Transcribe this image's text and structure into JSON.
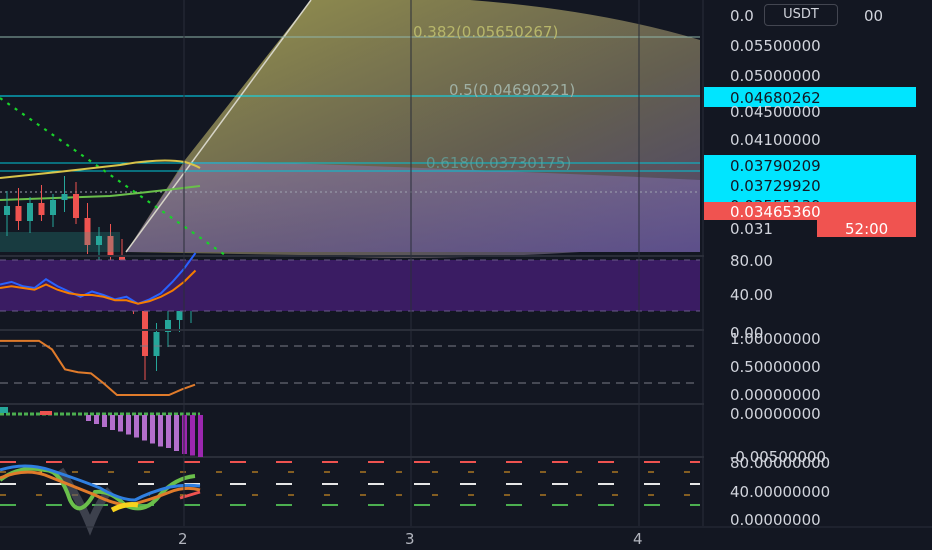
{
  "currency_button": "USDT",
  "price_axis_labels": [
    "0.05500000",
    "0.05000000",
    "0.04500000",
    "0.04100000"
  ],
  "price_axis_top_partial": "0.0",
  "price_axis_top_partial_tail": "00",
  "price_axis_bottom_partial": "0.031",
  "fib_labels": [
    {
      "text": "0.382(0.05650267)",
      "color": "#b7b66a"
    },
    {
      "text": "0.5(0.04690221)",
      "color": "#9fb0a4"
    },
    {
      "text": "0.618(0.03730175)",
      "color": "#63a5a0"
    }
  ],
  "price_tags": [
    {
      "text": "0.04680262",
      "bg": "#00e5ff"
    },
    {
      "text": "0.03790209",
      "bg": "#00e5ff"
    },
    {
      "text": "0.03729920",
      "bg": "#00e5ff"
    },
    {
      "text": "0.03551139",
      "bg": "#00e5ff"
    },
    {
      "text": "0.03465360",
      "bg": "#f05350"
    }
  ],
  "countdown_tag": {
    "text": "52:00",
    "bg": "#f05350"
  },
  "rsi_axis": [
    "80.00",
    "40.00",
    "0.00"
  ],
  "stoch_axis": [
    "1.00000000",
    "0.50000000",
    "0.00000000"
  ],
  "macd_axis": [
    "0.00000000",
    "-0.00500000"
  ],
  "last_axis": [
    "80.00000000",
    "40.00000000",
    "0.00000000"
  ],
  "time_labels": [
    "2",
    "3",
    "4"
  ],
  "colors": {
    "background": "#131722",
    "up_candle": "#26a69a",
    "down_candle": "#ef5350",
    "fib_zone": "#c9c45a",
    "rsi_band": "#3a1c63",
    "rsi_blue": "#2962ff",
    "rsi_orange": "#f57c00",
    "histogram": "#b36fcc",
    "cyan": "#00e5ff"
  },
  "chart_data": {
    "type": "candlestick",
    "candles": [
      {
        "o": 0.0385,
        "h": 0.0393,
        "l": 0.0378,
        "c": 0.0388
      },
      {
        "o": 0.0388,
        "h": 0.0394,
        "l": 0.038,
        "c": 0.0383
      },
      {
        "o": 0.0383,
        "h": 0.0391,
        "l": 0.0379,
        "c": 0.0389
      },
      {
        "o": 0.0389,
        "h": 0.0395,
        "l": 0.0383,
        "c": 0.0385
      },
      {
        "o": 0.0385,
        "h": 0.0392,
        "l": 0.0381,
        "c": 0.039
      },
      {
        "o": 0.039,
        "h": 0.0398,
        "l": 0.0386,
        "c": 0.0392
      },
      {
        "o": 0.0392,
        "h": 0.0396,
        "l": 0.0382,
        "c": 0.0384
      },
      {
        "o": 0.0384,
        "h": 0.0389,
        "l": 0.0372,
        "c": 0.0375
      },
      {
        "o": 0.0375,
        "h": 0.0381,
        "l": 0.0366,
        "c": 0.0378
      },
      {
        "o": 0.0378,
        "h": 0.0382,
        "l": 0.0369,
        "c": 0.0371
      },
      {
        "o": 0.0371,
        "h": 0.0377,
        "l": 0.036,
        "c": 0.0364
      },
      {
        "o": 0.0364,
        "h": 0.037,
        "l": 0.0352,
        "c": 0.0356
      },
      {
        "o": 0.0356,
        "h": 0.0362,
        "l": 0.033,
        "c": 0.0338
      },
      {
        "o": 0.0338,
        "h": 0.0349,
        "l": 0.0333,
        "c": 0.0346
      },
      {
        "o": 0.0346,
        "h": 0.0354,
        "l": 0.0341,
        "c": 0.035
      },
      {
        "o": 0.035,
        "h": 0.0355,
        "l": 0.0346,
        "c": 0.0353
      },
      {
        "o": 0.0353,
        "h": 0.0358,
        "l": 0.0349,
        "c": 0.0355
      }
    ],
    "fib_levels": [
      {
        "ratio": 0.382,
        "price": 0.05650267
      },
      {
        "ratio": 0.5,
        "price": 0.04690221
      },
      {
        "ratio": 0.618,
        "price": 0.03730175
      }
    ],
    "rsi": {
      "blue": [
        52,
        55,
        50,
        48,
        58,
        50,
        44,
        38,
        44,
        40,
        35,
        38,
        30,
        35,
        42,
        55,
        70,
        88
      ],
      "orange": [
        48,
        50,
        48,
        46,
        52,
        46,
        42,
        40,
        40,
        38,
        34,
        34,
        30,
        33,
        38,
        45,
        55,
        68
      ]
    },
    "stoch": [
      0.95,
      0.95,
      0.95,
      0.95,
      0.8,
      0.45,
      0.4,
      0.38,
      0.2,
      0.0,
      0.0,
      0.0,
      0.0,
      0.0,
      0.1,
      0.18
    ],
    "macd_hist": [
      -0.0004,
      -0.0006,
      -0.0008,
      -0.001,
      -0.0011,
      -0.0013,
      -0.0015,
      -0.0017,
      -0.0019,
      -0.0021,
      -0.0022,
      -0.0024,
      -0.0026,
      -0.0027,
      -0.0028
    ],
    "x_ticks": [
      "2",
      "3",
      "4"
    ]
  }
}
